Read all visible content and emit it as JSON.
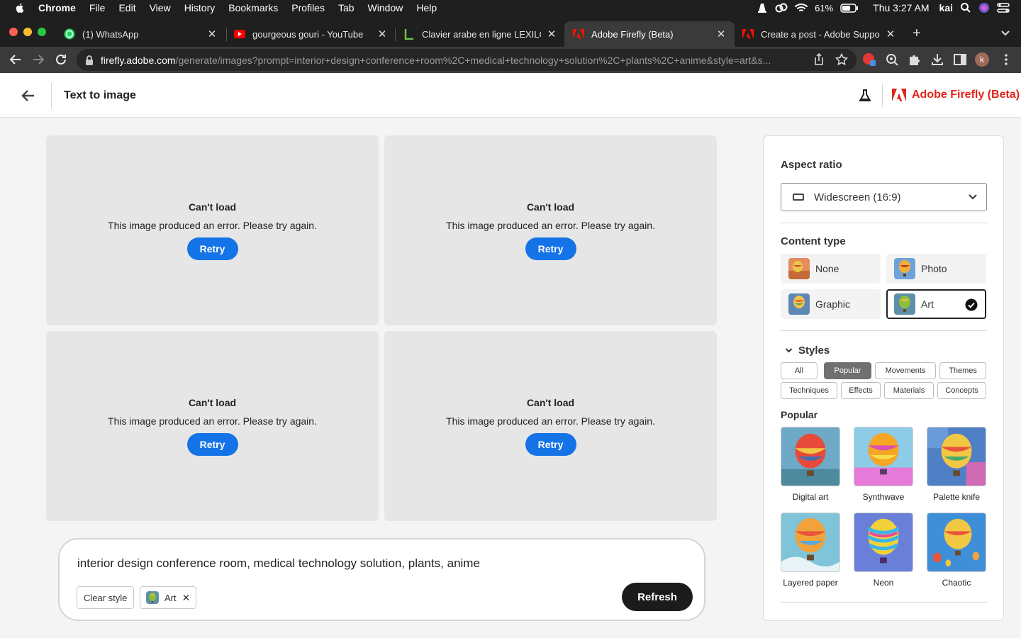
{
  "menubar": {
    "app": "Chrome",
    "items": [
      "File",
      "Edit",
      "View",
      "History",
      "Bookmarks",
      "Profiles",
      "Tab",
      "Window",
      "Help"
    ],
    "battery": "61%",
    "clock": "Thu 3:27 AM",
    "user": "kai"
  },
  "tabs": [
    {
      "title": "(1) WhatsApp",
      "icon": "whatsapp-icon",
      "active": false
    },
    {
      "title": "gourgeous gouri - YouTube",
      "icon": "youtube-icon",
      "active": false
    },
    {
      "title": "Clavier arabe en ligne LEXILOGOS",
      "icon": "lexilogos-icon",
      "active": false
    },
    {
      "title": "Adobe Firefly (Beta)",
      "icon": "adobe-icon",
      "active": true
    },
    {
      "title": "Create a post - Adobe Support Community",
      "icon": "adobe-icon",
      "active": false
    }
  ],
  "address": {
    "host": "firefly.adobe.com",
    "path": "/generate/images?prompt=interior+design+conference+room%2C+medical+technology+solution%2C+plants%2C+anime&style=art&s..."
  },
  "profile_initial": "k",
  "header": {
    "title": "Text to image",
    "brand": "Adobe Firefly (Beta)"
  },
  "images": [
    {
      "error_title": "Can't load",
      "error_message": "This image produced an error. Please try again.",
      "retry_label": "Retry"
    },
    {
      "error_title": "Can't load",
      "error_message": "This image produced an error. Please try again.",
      "retry_label": "Retry"
    },
    {
      "error_title": "Can't load",
      "error_message": "This image produced an error. Please try again.",
      "retry_label": "Retry"
    },
    {
      "error_title": "Can't load",
      "error_message": "This image produced an error. Please try again.",
      "retry_label": "Retry"
    }
  ],
  "prompt": {
    "text": "interior design conference room, medical technology solution, plants, anime",
    "clear_style_label": "Clear style",
    "style_chip_label": "Art",
    "refresh_label": "Refresh"
  },
  "panel": {
    "aspect_ratio_label": "Aspect ratio",
    "aspect_ratio_value": "Widescreen (16:9)",
    "content_type_label": "Content type",
    "content_types": [
      "None",
      "Photo",
      "Graphic",
      "Art"
    ],
    "content_type_selected": "Art",
    "styles_label": "Styles",
    "style_categories": [
      "All",
      "Popular",
      "Movements",
      "Themes",
      "Techniques",
      "Effects",
      "Materials",
      "Concepts"
    ],
    "style_category_selected": "Popular",
    "popular_label": "Popular",
    "popular_styles": [
      "Digital art",
      "Synthwave",
      "Palette knife",
      "Layered paper",
      "Neon",
      "Chaotic"
    ]
  },
  "colors": {
    "accent_blue": "#1473e6",
    "adobe_red": "#e1251b",
    "refresh_bg": "#1b1b1b"
  }
}
